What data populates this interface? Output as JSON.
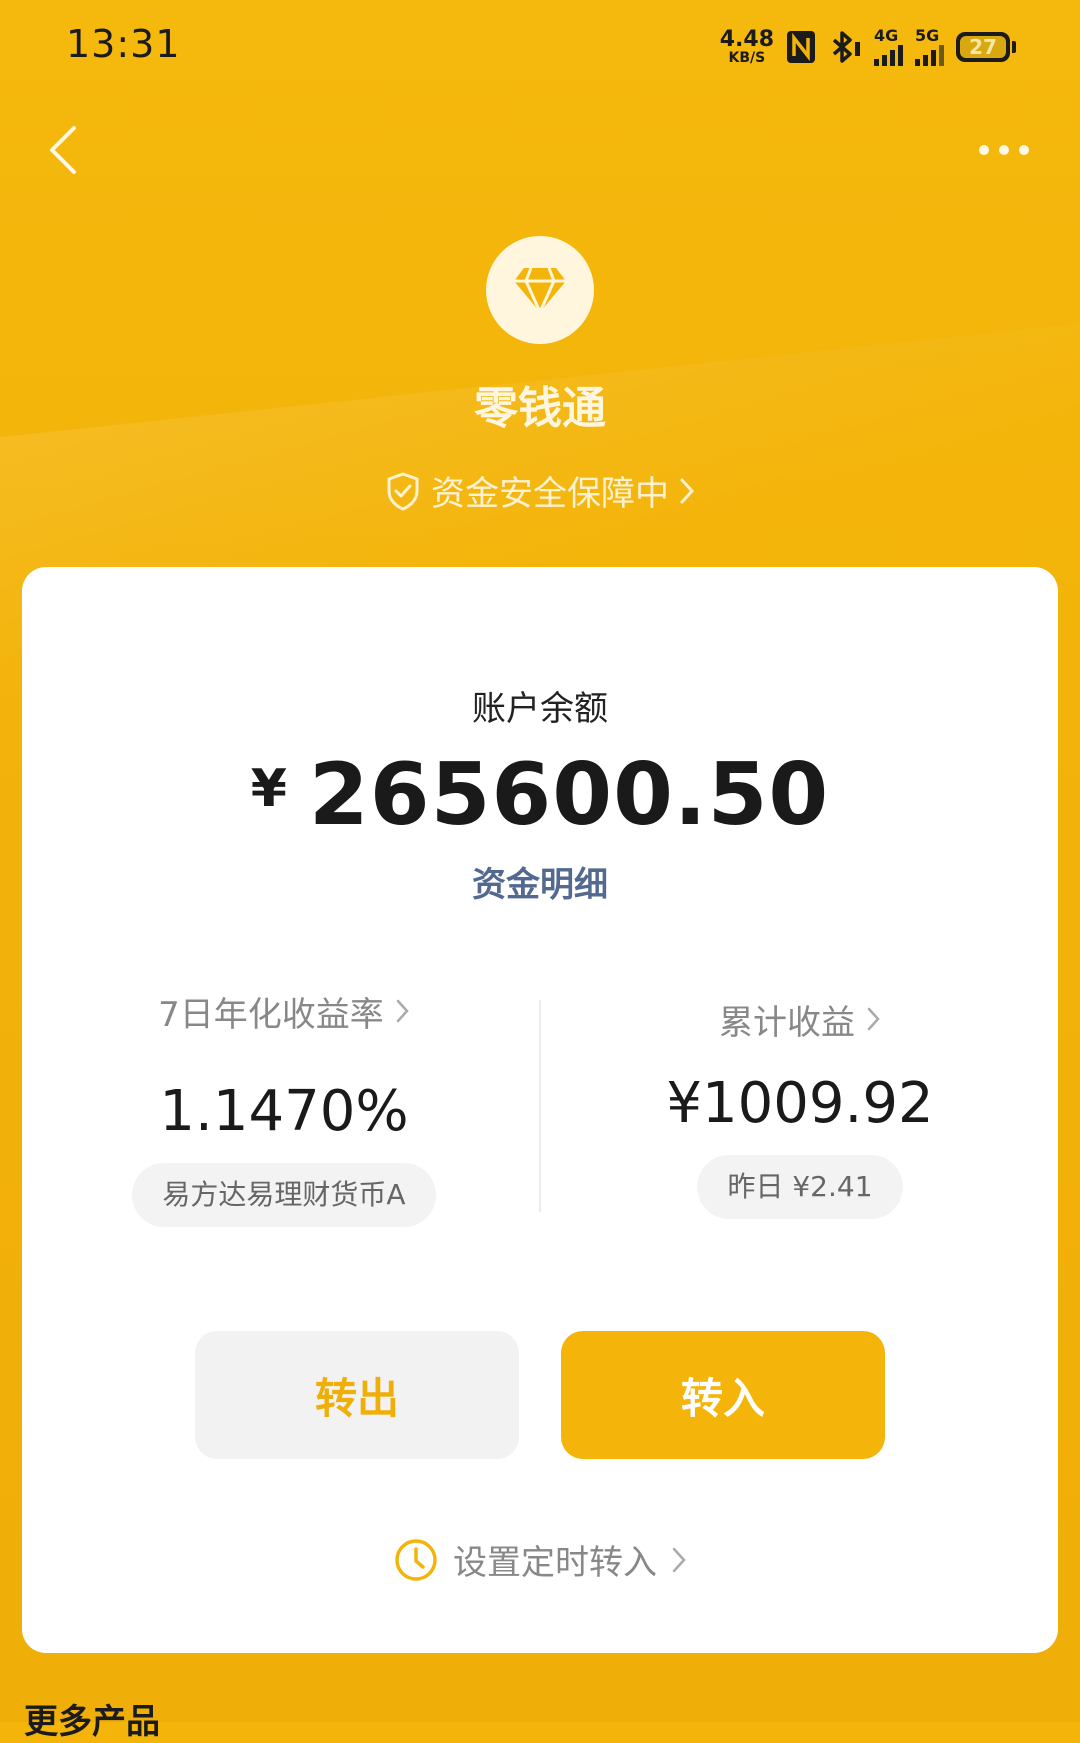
{
  "status_bar": {
    "time": "13:31",
    "net_speed_value": "4.48",
    "net_speed_unit": "KB/S",
    "signal1_label": "4G",
    "signal2_label": "5G",
    "battery": "27"
  },
  "header": {
    "product_name": "零钱通",
    "safety_text": "资金安全保障中"
  },
  "card": {
    "balance_label": "账户余额",
    "currency": "¥",
    "balance": "265600.50",
    "detail_link": "资金明细",
    "yield": {
      "title": "7日年化收益率",
      "value": "1.1470%",
      "fund": "易方达易理财货币A"
    },
    "earnings": {
      "title": "累计收益",
      "value": "¥1009.92",
      "yesterday": "昨日 ¥2.41"
    },
    "transfer_out": "转出",
    "transfer_in": "转入",
    "timer_link": "设置定时转入"
  },
  "footer": {
    "more_products": "更多产品"
  },
  "colors": {
    "brand": "#F4B40A",
    "link": "#53698f"
  }
}
